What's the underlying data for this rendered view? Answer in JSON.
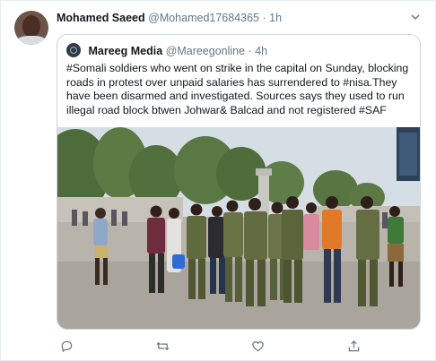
{
  "tweet": {
    "author_name": "Mohamed Saeed",
    "author_handle": "@Mohamed17684365",
    "separator": "·",
    "time": "1h",
    "menu_icon": "chevron-down-icon"
  },
  "quoted": {
    "author_name": "Mareeg Media",
    "author_handle": "@Mareegonline",
    "separator": "·",
    "time": "4h",
    "text": "#Somali soldiers who went on strike in the capital  on Sunday, blocking roads in protest over unpaid salaries has surrendered  to #nisa.They have been disarmed and investigated. Sources says they used to run illegal road block btwen Johwar& Balcad and not registered #SAF"
  },
  "actions": [
    {
      "icon": "reply-icon"
    },
    {
      "icon": "retweet-icon"
    },
    {
      "icon": "like-icon"
    },
    {
      "icon": "share-icon"
    }
  ],
  "colors": {
    "text": "#14171a",
    "secondary": "#657786",
    "border": "#ccd6dd"
  }
}
